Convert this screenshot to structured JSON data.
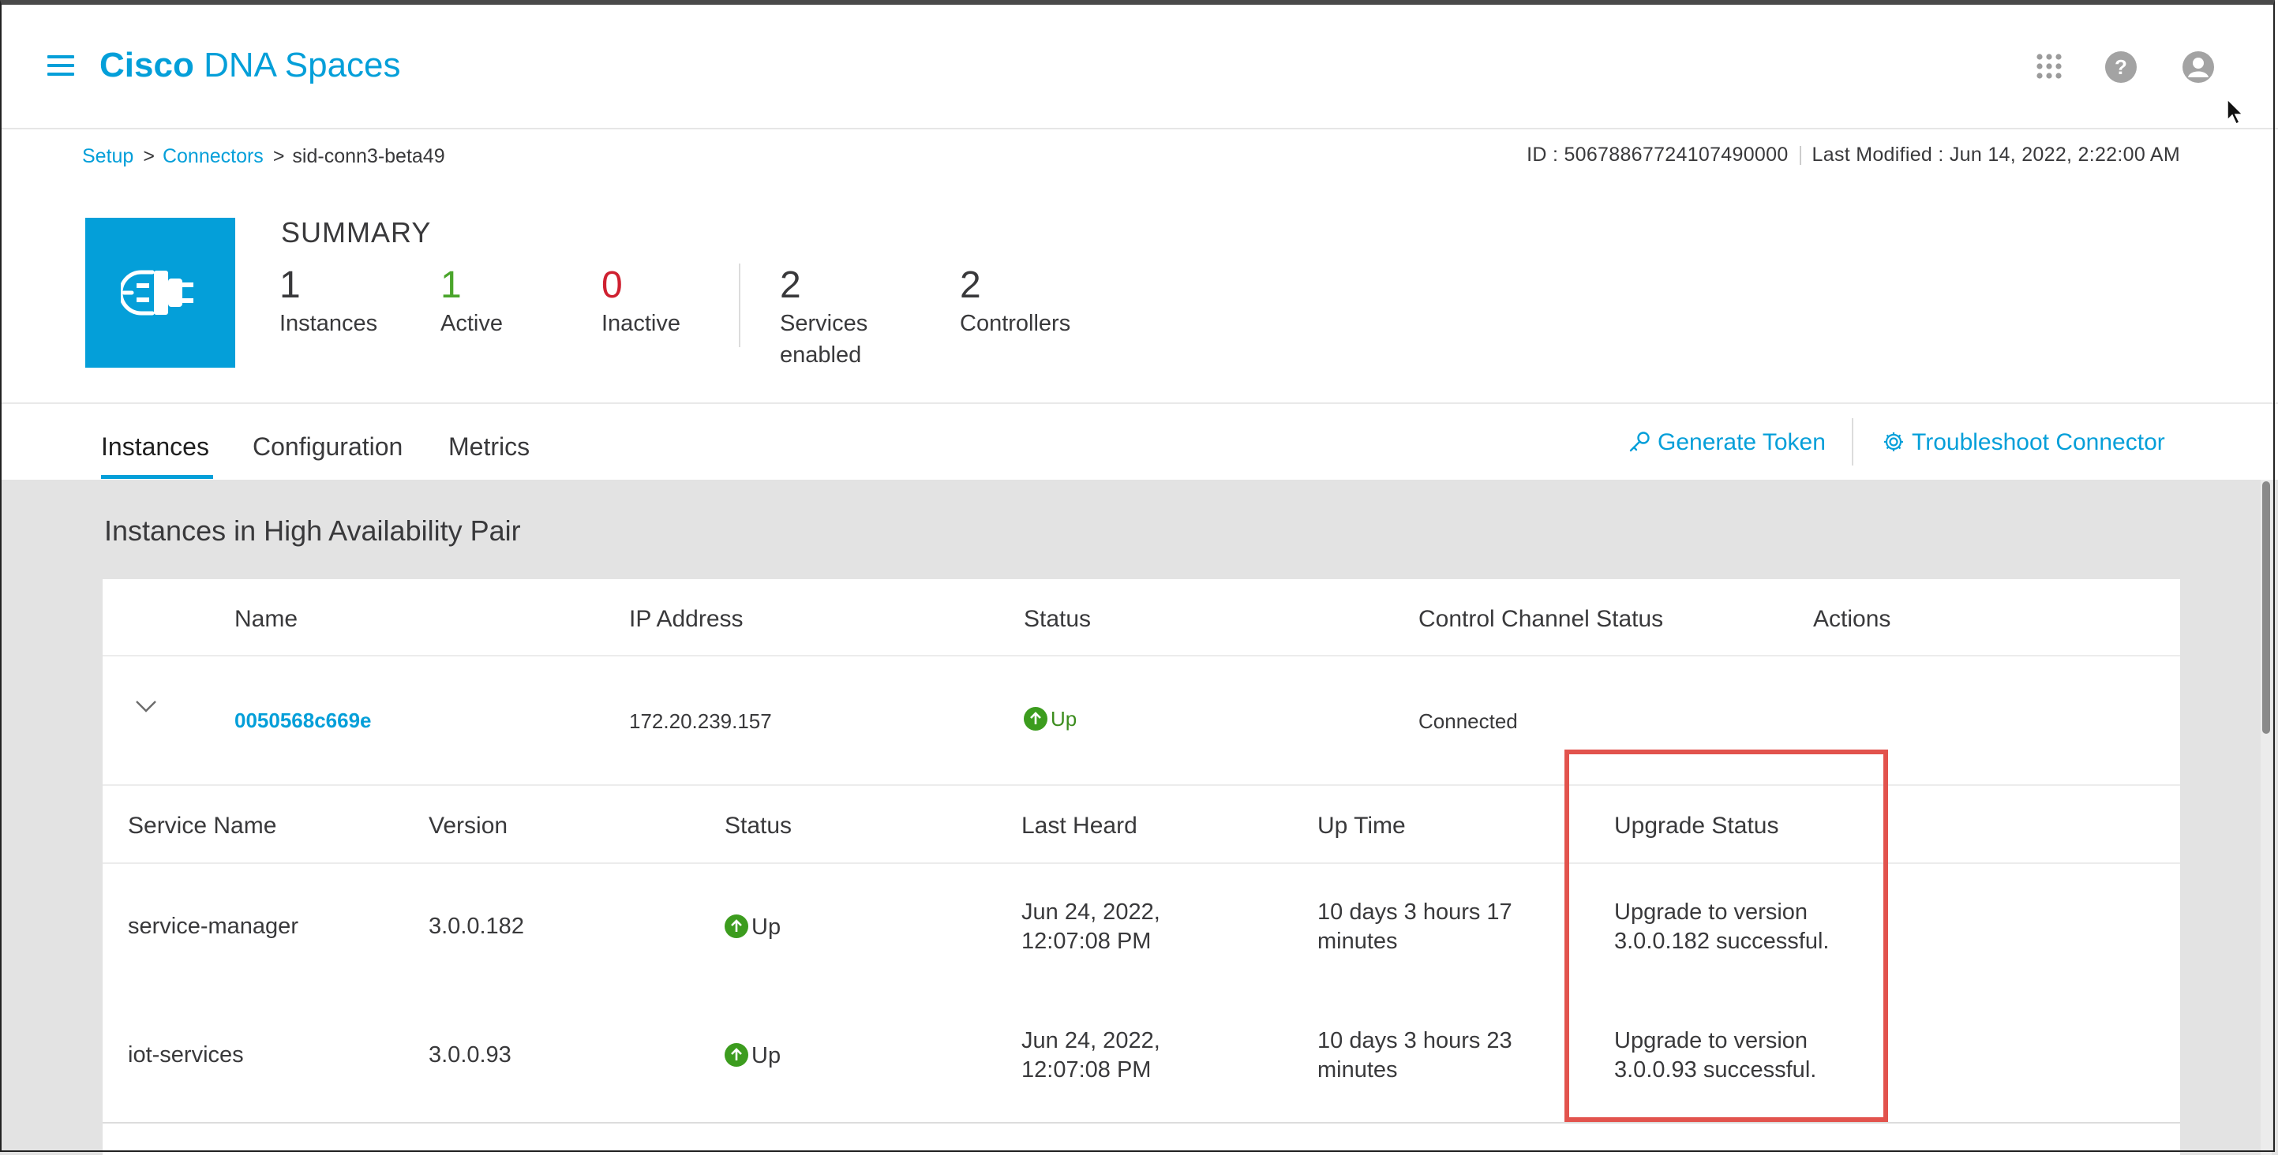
{
  "header": {
    "brand_bold": "Cisco",
    "brand_rest": "DNA Spaces"
  },
  "breadcrumb": {
    "items": [
      "Setup",
      "Connectors"
    ],
    "separator": ">",
    "current": "sid-conn3-beta49"
  },
  "meta": {
    "id_text": "ID : 50678867724107490000",
    "last_modified_text": "Last Modified : Jun 14, 2022, 2:22:00 AM"
  },
  "summary": {
    "title": "SUMMARY",
    "stats": [
      {
        "value": "1",
        "label": "Instances"
      },
      {
        "value": "1",
        "label": "Active"
      },
      {
        "value": "0",
        "label": "Inactive"
      },
      {
        "value": "2",
        "label_line1": "Services",
        "label_line2": "enabled"
      },
      {
        "value": "2",
        "label": "Controllers"
      }
    ]
  },
  "tabs": [
    {
      "label": "Instances",
      "active": true
    },
    {
      "label": "Configuration",
      "active": false
    },
    {
      "label": "Metrics",
      "active": false
    }
  ],
  "actions": {
    "generate_token": "Generate Token",
    "troubleshoot": "Troubleshoot Connector"
  },
  "section": {
    "title": "Instances in High Availability Pair"
  },
  "instances_table": {
    "columns": [
      "Name",
      "IP Address",
      "Status",
      "Control Channel Status",
      "Actions"
    ],
    "rows": [
      {
        "name": "0050568c669e",
        "ip": "172.20.239.157",
        "status": "Up",
        "control_channel": "Connected"
      }
    ]
  },
  "services_table": {
    "columns": [
      "Service Name",
      "Version",
      "Status",
      "Last Heard",
      "Up Time",
      "Upgrade Status"
    ],
    "rows": [
      {
        "service": "service-manager",
        "version": "3.0.0.182",
        "status": "Up",
        "last_heard_1": "Jun 24, 2022,",
        "last_heard_2": "12:07:08 PM",
        "uptime_1": "10 days 3 hours 17",
        "uptime_2": "minutes",
        "upgrade_1": "Upgrade to version",
        "upgrade_2": "3.0.0.182 successful."
      },
      {
        "service": "iot-services",
        "version": "3.0.0.93",
        "status": "Up",
        "last_heard_1": "Jun 24, 2022,",
        "last_heard_2": "12:07:08 PM",
        "uptime_1": "10 days 3 hours 23",
        "uptime_2": "minutes",
        "upgrade_1": "Upgrade to version",
        "upgrade_2": "3.0.0.93 successful."
      }
    ]
  },
  "colors": {
    "brand": "#049fd9",
    "active_green": "#4aa52b",
    "inactive_red": "#cf2030",
    "highlight": "#e2534d",
    "content_bg": "#e3e3e3"
  },
  "icons": [
    "menu-icon",
    "apps-grid-icon",
    "help-icon",
    "user-icon",
    "connector-plug-icon",
    "key-icon",
    "gear-icon",
    "chevron-down-icon",
    "status-up-icon",
    "mouse-cursor-icon"
  ]
}
